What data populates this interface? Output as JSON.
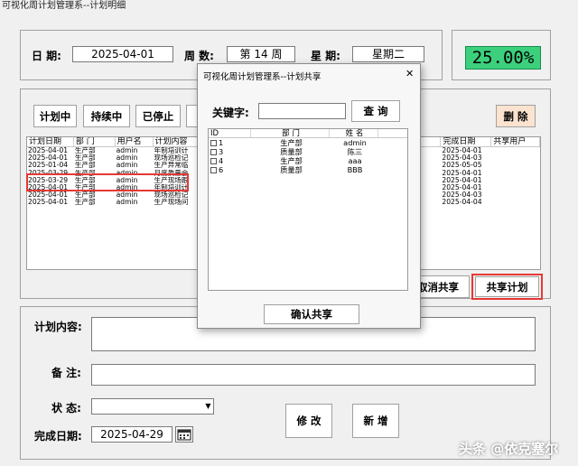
{
  "window": {
    "title": "可视化周计划管理系--计划明细"
  },
  "header": {
    "date_label": "日 期:",
    "date_value": "2025-04-01",
    "week_label": "周 数:",
    "week_value": "第 14 周",
    "weekday_label": "星 期:",
    "weekday_value": "星期二",
    "percent": "25.00%"
  },
  "toolbar": {
    "planning": "计划中",
    "ongoing": "持续中",
    "stopped": "已停止",
    "delete": "删 除",
    "cancel_share": "取消共享",
    "share_plan": "共享计划"
  },
  "grid": {
    "columns": [
      "计划日期",
      "部 门",
      "用户名",
      "计划内容",
      "完成日期",
      "共享用户"
    ],
    "rows": [
      [
        "2025-04-01",
        "生产部",
        "admin",
        "年制培训计",
        "2025-04-01",
        ""
      ],
      [
        "2025-04-01",
        "生产部",
        "admin",
        "现场巡检记",
        "2025-04-03",
        ""
      ],
      [
        "2025-01-04",
        "生产部",
        "admin",
        "生产异常临",
        "2025-05-05",
        ""
      ],
      [
        "2025-03-29",
        "生产部",
        "admin",
        "月度质量会",
        "2025-04-01",
        ""
      ],
      [
        "2025-03-29",
        "生产部",
        "admin",
        "生产现场跟",
        "2025-04-01",
        ""
      ],
      [
        "2025-04-01",
        "生产部",
        "admin",
        "年制培训计",
        "2025-04-01",
        ""
      ],
      [
        "2025-04-01",
        "生产部",
        "admin",
        "现场巡检记",
        "2025-04-03",
        ""
      ],
      [
        "2025-04-01",
        "生产部",
        "admin",
        "生产现场问",
        "2025-04-04",
        ""
      ]
    ]
  },
  "form": {
    "content_label": "计划内容:",
    "note_label": "备 注:",
    "status_label": "状 态:",
    "finish_label": "完成日期:",
    "finish_value": "2025-04-29",
    "modify": "修 改",
    "add": "新 增"
  },
  "dialog": {
    "title": "可视化周计划管理系--计划共享",
    "close": "✕",
    "keyword_label": "关键字:",
    "search": "查 询",
    "columns": [
      "ID",
      "部 门",
      "姓 名"
    ],
    "rows": [
      {
        "id": "1",
        "dept": "生产部",
        "name": "admin"
      },
      {
        "id": "3",
        "dept": "质量部",
        "name": "陈三"
      },
      {
        "id": "4",
        "dept": "生产部",
        "name": "aaa"
      },
      {
        "id": "6",
        "dept": "质量部",
        "name": "BBB"
      }
    ],
    "confirm": "确认共享"
  },
  "watermark": "头条 @依克塞尔",
  "colors": {
    "percent_bg": "#3cd07d",
    "highlight": "#e53935",
    "delete_bg": "#fbe3cf"
  }
}
